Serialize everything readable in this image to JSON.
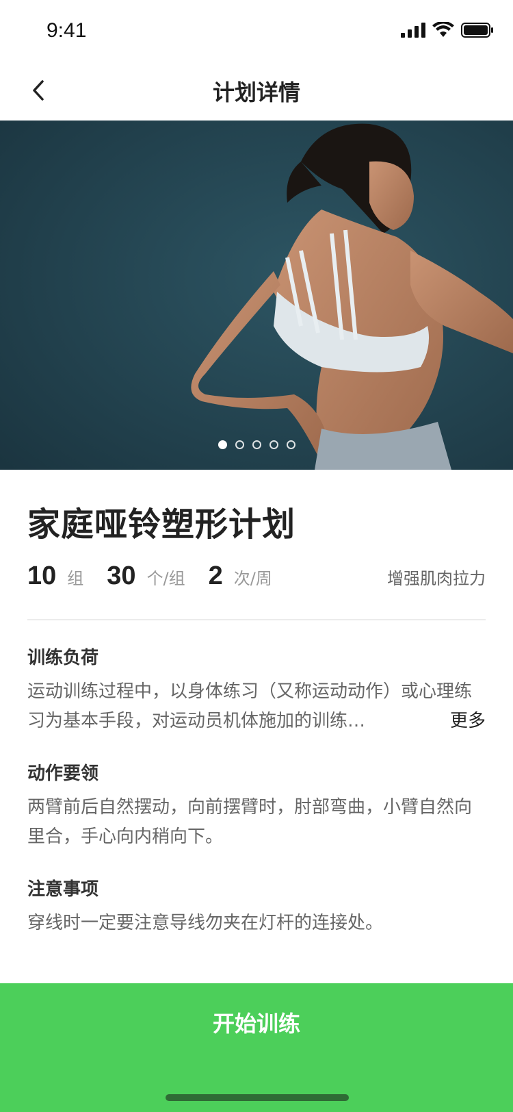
{
  "status_bar": {
    "time": "9:41"
  },
  "nav": {
    "title": "计划详情"
  },
  "hero": {
    "slide_count": 5,
    "active_slide": 1
  },
  "plan": {
    "title": "家庭哑铃塑形计划",
    "stats": [
      {
        "value": "10",
        "unit": "组"
      },
      {
        "value": "30",
        "unit": "个/组"
      },
      {
        "value": "2",
        "unit": "次/周"
      }
    ],
    "tag": "增强肌肉拉力"
  },
  "sections": {
    "load": {
      "title": "训练负荷",
      "body": "运动训练过程中，以身体练习（又称运动动作）或心理练习为基本手段，对运动员机体施加的训练…",
      "more": "更多"
    },
    "key_points": {
      "title": "动作要领",
      "body": "两臂前后自然摆动，向前摆臂时，肘部弯曲，小臂自然向里合，手心向内稍向下。"
    },
    "notes": {
      "title": "注意事项",
      "body": "穿线时一定要注意导线勿夹在灯杆的连接处。"
    }
  },
  "start_button": {
    "label": "开始训练"
  },
  "colors": {
    "accent": "#4ccf5a",
    "hero_bg": "#22414e"
  }
}
